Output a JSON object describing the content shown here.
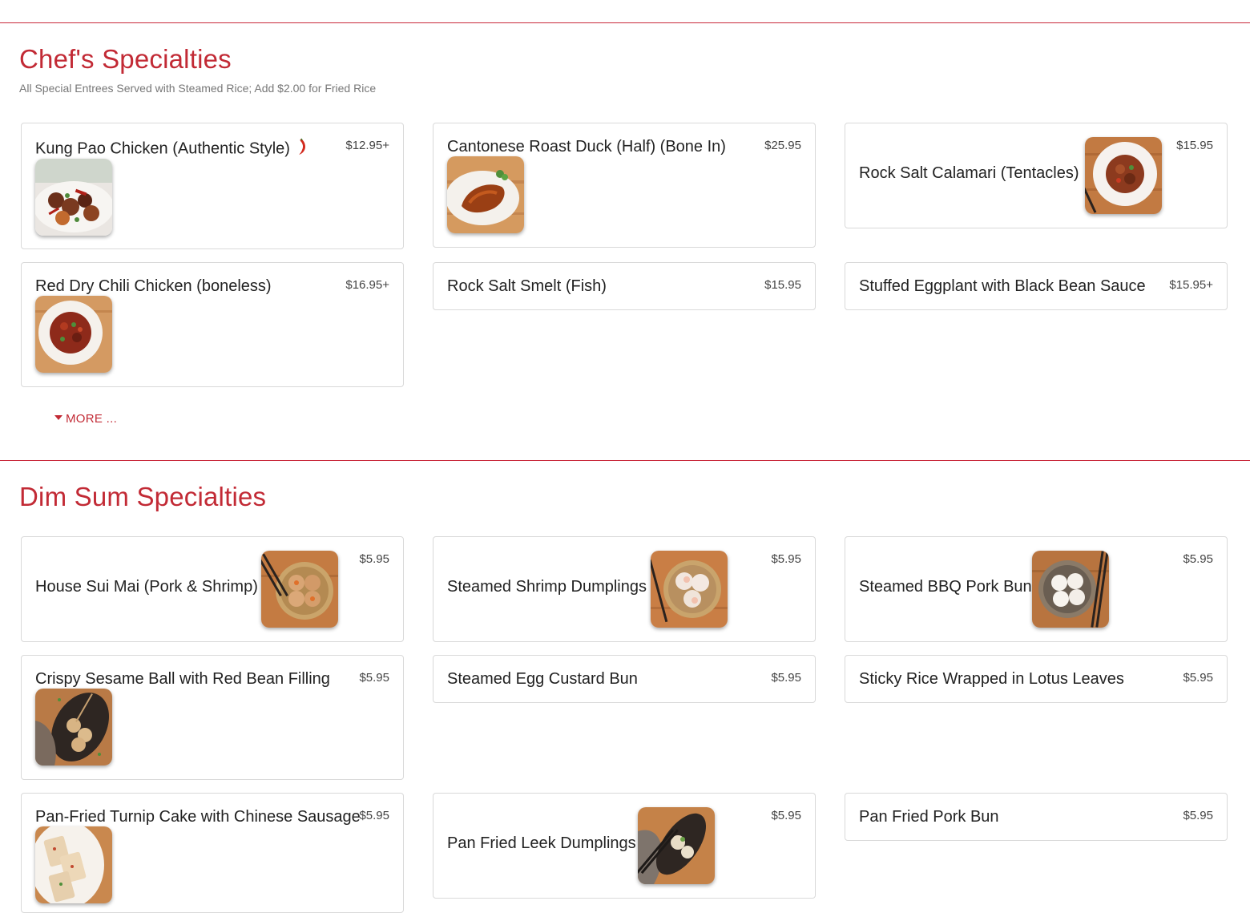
{
  "chefs": {
    "title": "Chef's Specialties",
    "subtitle": "All Special Entrees Served with Steamed Rice; Add $2.00 for Fried Rice",
    "more_label": "MORE ...",
    "items": [
      {
        "name": "Kung Pao Chicken (Authentic Style)",
        "price": "$12.95+",
        "spicy_icon": "chili-pepper-icon"
      },
      {
        "name": "Cantonese Roast Duck (Half) (Bone In)",
        "price": "$25.95"
      },
      {
        "name": "Rock Salt Calamari (Tentacles)",
        "price": "$15.95"
      },
      {
        "name": "Red Dry Chili Chicken (boneless)",
        "price": "$16.95+"
      },
      {
        "name": "Rock Salt Smelt (Fish)",
        "price": "$15.95"
      },
      {
        "name": "Stuffed Eggplant with Black Bean Sauce",
        "price": "$15.95+"
      }
    ]
  },
  "dimsum": {
    "title": "Dim Sum Specialties",
    "items": [
      {
        "name": "House Sui Mai (Pork & Shrimp)",
        "price": "$5.95"
      },
      {
        "name": "Steamed Shrimp Dumplings",
        "price": "$5.95"
      },
      {
        "name": "Steamed BBQ Pork Bun",
        "price": "$5.95"
      },
      {
        "name": "Crispy Sesame Ball with Red Bean Filling",
        "price": "$5.95"
      },
      {
        "name": "Steamed Egg Custard Bun",
        "price": "$5.95"
      },
      {
        "name": "Sticky Rice Wrapped in Lotus Leaves",
        "price": "$5.95"
      },
      {
        "name": "Pan-Fried Turnip Cake with Chinese Sausage",
        "price": "$5.95"
      },
      {
        "name": "Pan Fried Leek Dumplings",
        "price": "$5.95"
      },
      {
        "name": "Pan Fried Pork Bun",
        "price": "$5.95"
      }
    ]
  },
  "colors": {
    "accent": "#c22a35",
    "border": "#d9d9d9",
    "price_text": "#444444"
  }
}
